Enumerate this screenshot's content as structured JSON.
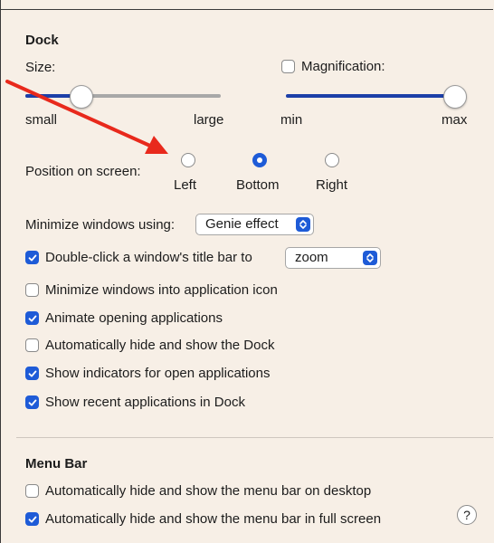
{
  "dock": {
    "heading": "Dock",
    "size_label": "Size:",
    "size_min_label": "small",
    "size_max_label": "large",
    "size_value": 0.3,
    "magnification_label": "Magnification:",
    "magnification_checked": false,
    "mag_min_label": "min",
    "mag_max_label": "max",
    "mag_value": 1.0,
    "position_label": "Position on screen:",
    "positions": [
      {
        "label": "Left",
        "selected": false
      },
      {
        "label": "Bottom",
        "selected": true
      },
      {
        "label": "Right",
        "selected": false
      }
    ],
    "minimize_label": "Minimize windows using:",
    "minimize_value": "Genie effect",
    "doubleclick_label": "Double-click a window's title bar to",
    "doubleclick_checked": true,
    "doubleclick_value": "zoom",
    "checkboxes": [
      {
        "label": "Minimize windows into application icon",
        "checked": false
      },
      {
        "label": "Animate opening applications",
        "checked": true
      },
      {
        "label": "Automatically hide and show the Dock",
        "checked": false
      },
      {
        "label": "Show indicators for open applications",
        "checked": true
      },
      {
        "label": "Show recent applications in Dock",
        "checked": true
      }
    ]
  },
  "menu_bar": {
    "heading": "Menu Bar",
    "checkboxes": [
      {
        "label": "Automatically hide and show the menu bar on desktop",
        "checked": false
      },
      {
        "label": "Automatically hide and show the menu bar in full screen",
        "checked": true
      }
    ]
  },
  "help_label": "?",
  "colors": {
    "accent": "#1e5bd7",
    "annotation_arrow": "#e8291c",
    "background": "#f7efe6"
  }
}
